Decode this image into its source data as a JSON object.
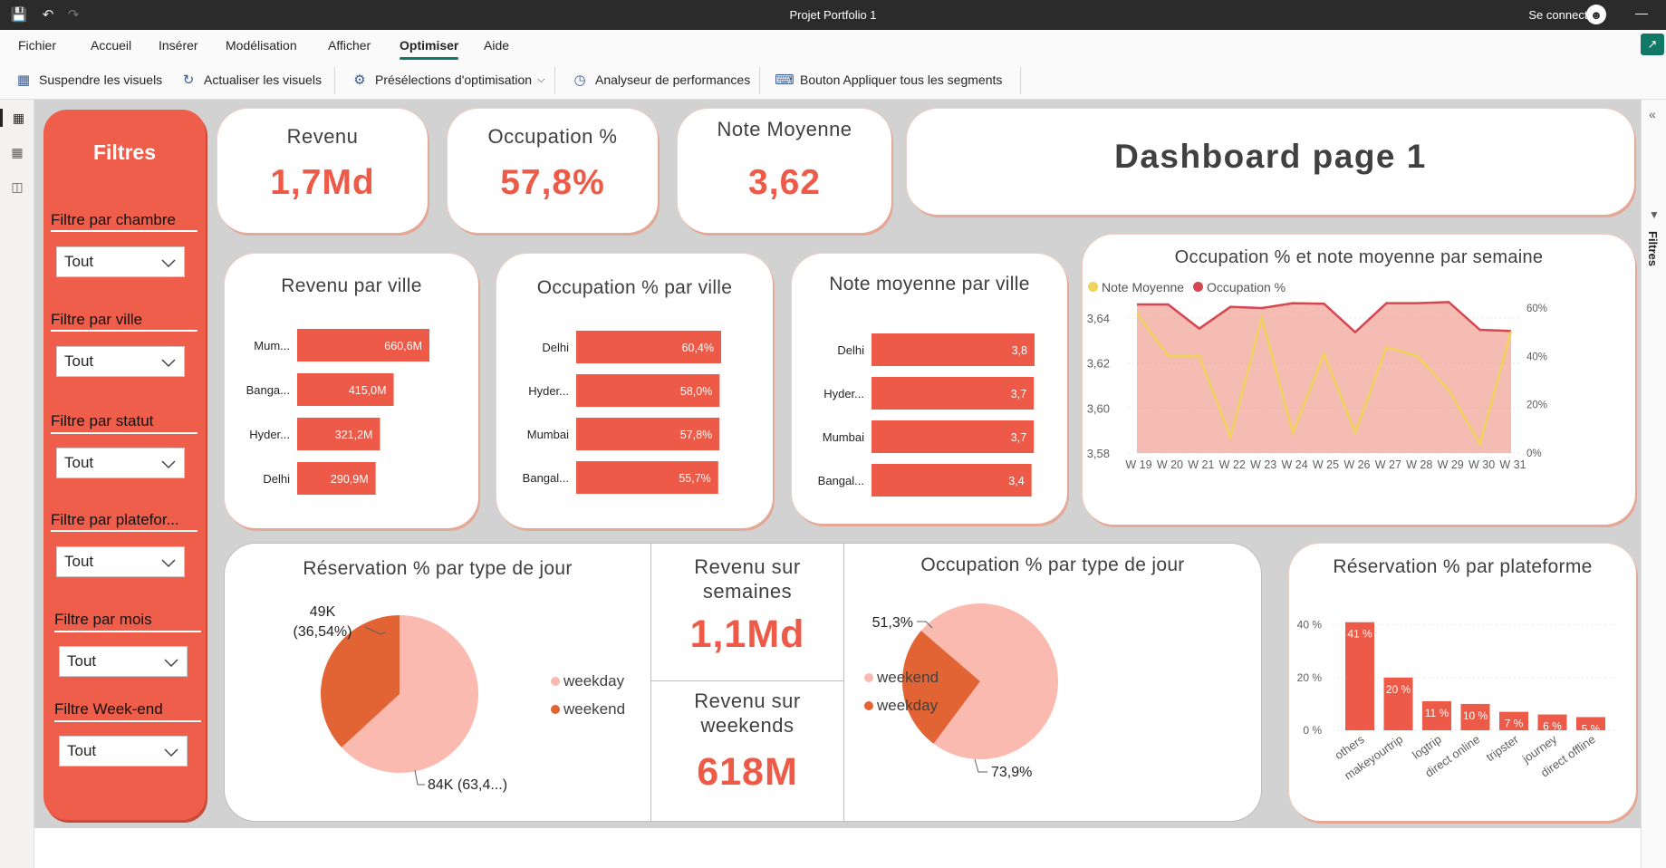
{
  "app": {
    "title": "Projet Portfolio 1",
    "signin": "Se connecter"
  },
  "menu": {
    "items": [
      "Fichier",
      "Accueil",
      "Insérer",
      "Modélisation",
      "Afficher",
      "Optimiser",
      "Aide"
    ],
    "active": "Optimiser"
  },
  "ribbon": {
    "pause_visuals": "Suspendre les visuels",
    "refresh_visuals": "Actualiser les visuels",
    "presets": "Présélections d'optimisation",
    "perf_analyzer": "Analyseur de performances",
    "apply_slicers": "Bouton Appliquer tous les segments"
  },
  "right_pane": {
    "label": "Filtres"
  },
  "filters": {
    "title": "Filtres",
    "items": [
      {
        "label": "Filtre par chambre",
        "value": "Tout"
      },
      {
        "label": "Filtre par ville",
        "value": "Tout"
      },
      {
        "label": "Filtre par statut",
        "value": "Tout"
      },
      {
        "label": "Filtre par platefor...",
        "value": "Tout"
      },
      {
        "label": "Filtre par mois",
        "value": "Tout"
      },
      {
        "label": "Filtre Week-end",
        "value": "Tout"
      }
    ]
  },
  "kpis": {
    "revenue": {
      "label": "Revenu",
      "value": "1,7Md"
    },
    "occupancy": {
      "label": "Occupation %",
      "value": "57,8%"
    },
    "rating": {
      "label": "Note Moyenne",
      "value": "3,62"
    },
    "page_title": "Dashboard page 1",
    "rev_weeks": {
      "label": "Revenu sur semaines",
      "value": "1,1Md"
    },
    "rev_weekends": {
      "label": "Revenu sur weekends",
      "value": "618M"
    }
  },
  "colors": {
    "accent": "#ef5e4b",
    "bar": "#ee5a48",
    "pie_light": "#fbbab0",
    "pie_dark": "#e26434",
    "line_yellow": "#f0d35a",
    "line_red": "#d64550",
    "area_fill": "#ef9f93"
  },
  "chart_data": [
    {
      "id": "rev_city",
      "type": "bar",
      "title": "Revenu par ville",
      "categories": [
        "Mum...",
        "Banga...",
        "Hyder...",
        "Delhi"
      ],
      "values": [
        660.6,
        415.0,
        321.2,
        290.9
      ],
      "labels": [
        "660,6M",
        "415,0M",
        "321,2M",
        "290,9M"
      ],
      "orientation": "horizontal"
    },
    {
      "id": "occ_city",
      "type": "bar",
      "title": "Occupation % par ville",
      "categories": [
        "Delhi",
        "Hyder...",
        "Mumbai",
        "Bangal..."
      ],
      "values": [
        60.4,
        58.0,
        57.8,
        55.7
      ],
      "labels": [
        "60,4%",
        "58,0%",
        "57,8%",
        "55,7%"
      ],
      "orientation": "horizontal"
    },
    {
      "id": "rating_city",
      "type": "bar",
      "title": "Note moyenne par ville",
      "categories": [
        "Delhi",
        "Hyder...",
        "Mumbai",
        "Bangal..."
      ],
      "values": [
        3.8,
        3.7,
        3.7,
        3.4
      ],
      "labels": [
        "3,8",
        "3,7",
        "3,7",
        "3,4"
      ],
      "orientation": "horizontal"
    },
    {
      "id": "weekly",
      "type": "line",
      "title": "Occupation % et note moyenne par semaine",
      "categories": [
        "W 19",
        "W 20",
        "W 21",
        "W 22",
        "W 23",
        "W 24",
        "W 25",
        "W 26",
        "W 27",
        "W 28",
        "W 29",
        "W 30",
        "W 31"
      ],
      "series": [
        {
          "name": "Note Moyenne",
          "axis": "left",
          "values": [
            3.642,
            3.623,
            3.623,
            3.587,
            3.64,
            3.589,
            3.624,
            3.589,
            3.627,
            3.623,
            3.608,
            3.584,
            3.634
          ]
        },
        {
          "name": "Occupation %",
          "axis": "right",
          "type": "area",
          "values": [
            61.5,
            61.5,
            51.5,
            60.5,
            60.0,
            62.0,
            61.8,
            50.0,
            62.0,
            62.0,
            62.5,
            51.0,
            50.5
          ]
        }
      ],
      "y_left": {
        "ticks": [
          "3,64",
          "3,62",
          "3,60",
          "3,58"
        ],
        "ylim": [
          3.58,
          3.65
        ]
      },
      "y_right": {
        "ticks": [
          "60%",
          "40%",
          "20%",
          "0%"
        ],
        "ylim": [
          0,
          60
        ]
      },
      "grid": true,
      "legend": "top-left"
    },
    {
      "id": "resa_daytype",
      "type": "pie",
      "title": "Réservation % par type de jour",
      "labels": [
        "weekday",
        "weekend"
      ],
      "values": [
        84,
        49
      ],
      "data_labels": [
        "84K (63,4...)",
        "49K\n(36,54%)"
      ],
      "legend": "right"
    },
    {
      "id": "occ_daytype",
      "type": "pie",
      "title": "Occupation % par type de jour",
      "labels": [
        "weekend",
        "weekday"
      ],
      "values": [
        26.1,
        73.9
      ],
      "data_labels": [
        "51,3%",
        "73,9%"
      ],
      "legend": "left"
    },
    {
      "id": "resa_platform",
      "type": "bar",
      "title": "Réservation % par plateforme",
      "categories": [
        "others",
        "makeyourtrip",
        "logtrip",
        "direct online",
        "tripster",
        "journey",
        "direct offline"
      ],
      "values": [
        41,
        20,
        11,
        10,
        7,
        6,
        5
      ],
      "labels": [
        "41 %",
        "20 %",
        "11 %",
        "10 %",
        "7 %",
        "6 %",
        "5 %"
      ],
      "y_ticks": [
        "40 %",
        "20 %",
        "0 %"
      ],
      "ylim": [
        0,
        44
      ]
    }
  ]
}
